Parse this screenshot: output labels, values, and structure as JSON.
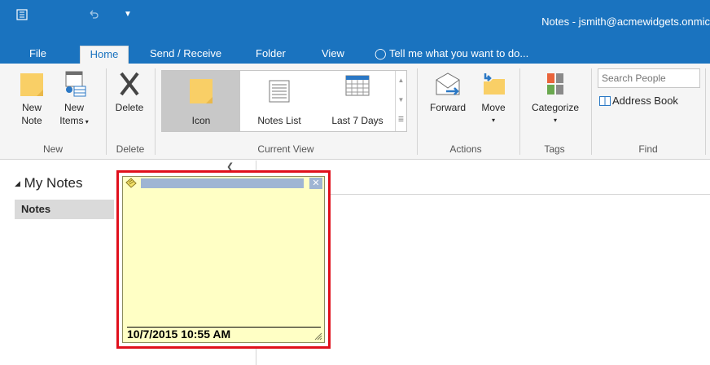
{
  "window": {
    "title": "Notes - jsmith@acmewidgets.onmic"
  },
  "quick_access": {
    "app_icon": "app-icon",
    "undo_icon": "undo-icon",
    "customize_icon": "customize-icon"
  },
  "tabs": [
    {
      "label": "File",
      "active": false
    },
    {
      "label": "Home",
      "active": true
    },
    {
      "label": "Send / Receive",
      "active": false
    },
    {
      "label": "Folder",
      "active": false
    },
    {
      "label": "View",
      "active": false
    }
  ],
  "tell_me": {
    "label": "Tell me what you want to do..."
  },
  "ribbon": {
    "new_note": {
      "label_1": "New",
      "label_2": "Note"
    },
    "new_items": {
      "label_1": "New",
      "label_2": "Items"
    },
    "delete": {
      "label": "Delete"
    },
    "views": [
      {
        "label": "Icon",
        "selected": true
      },
      {
        "label": "Notes List",
        "selected": false
      },
      {
        "label": "Last 7 Days",
        "selected": false
      }
    ],
    "forward": {
      "label": "Forward"
    },
    "move": {
      "label": "Move"
    },
    "categorize": {
      "label": "Categorize"
    },
    "search_people": {
      "placeholder": "Search People"
    },
    "address_book": {
      "label": "Address Book"
    },
    "groups": {
      "new": "New",
      "delete": "Delete",
      "current_view": "Current View",
      "actions": "Actions",
      "tags": "Tags",
      "find": "Find"
    }
  },
  "nav": {
    "header": "My Notes",
    "items": [
      {
        "label": "Notes",
        "selected": true
      }
    ]
  },
  "note": {
    "timestamp": "10/7/2015 10:55 AM"
  },
  "colors": {
    "accent": "#1a73bf",
    "highlight": "#e0101c",
    "note_bg": "#ffffc5"
  }
}
